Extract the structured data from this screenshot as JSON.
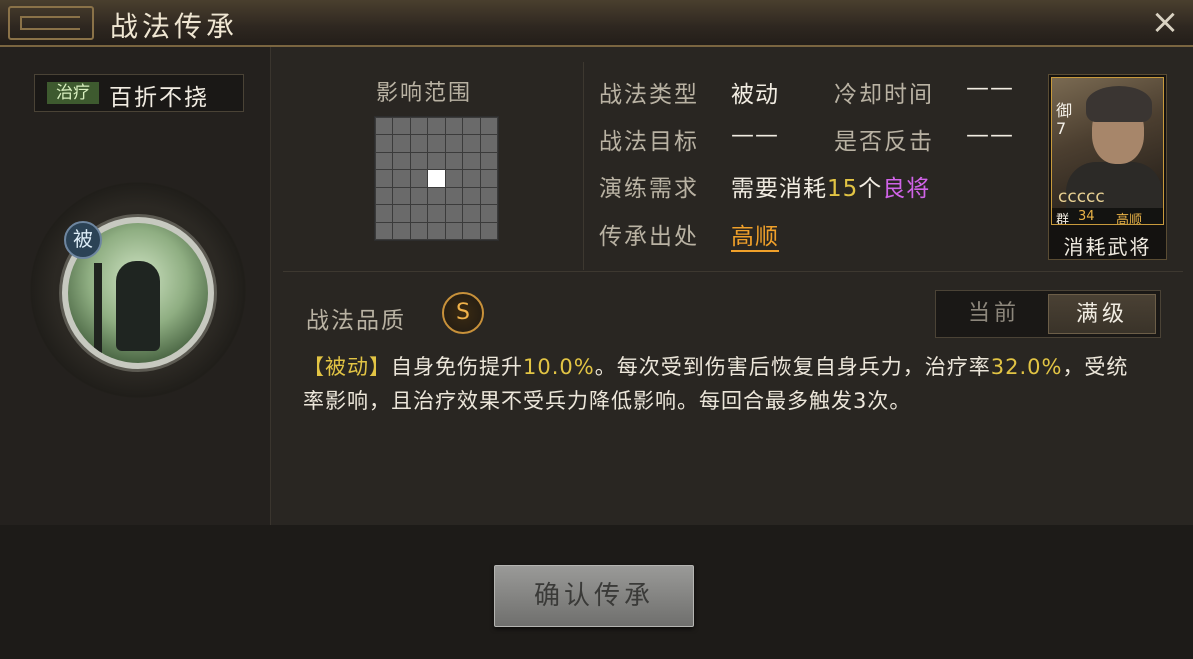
{
  "window": {
    "title": "战法传承",
    "close_icon": "×"
  },
  "skill": {
    "type_tag": "治疗",
    "name": "百折不挠",
    "passive_badge": "被"
  },
  "range": {
    "label": "影响范围",
    "grid_size": 7,
    "highlight": [
      3,
      3
    ]
  },
  "info": {
    "type_label": "战法类型",
    "type_value": "被动",
    "cooldown_label": "冷却时间",
    "cooldown_value": "——",
    "target_label": "战法目标",
    "target_value": "——",
    "counter_label": "是否反击",
    "counter_value": "——",
    "requirement_label": "演练需求",
    "requirement_prefix": "需要消耗",
    "requirement_count": "15",
    "requirement_unit": "个",
    "requirement_quality": "良将",
    "source_label": "传承出处",
    "source_value": "高顺"
  },
  "card": {
    "rank": "御7",
    "stars": "ccccc",
    "faction": "群",
    "level": "34",
    "general_name": "高顺",
    "caption": "消耗武将"
  },
  "quality": {
    "label": "战法品质",
    "grade": "S"
  },
  "toggle": {
    "current": "当前",
    "max": "满级",
    "selected": "max"
  },
  "description": {
    "tag": "【被动】",
    "part1": "自身免伤提升",
    "num1": "10.0%",
    "part2": "。每次受到伤害后恢复自身兵力，治疗率",
    "num2": "32.0%",
    "part3": "，受统率影响，且治疗效果不受兵力降低影响。每回合最多触发3次。"
  },
  "confirm_button": "确认传承"
}
